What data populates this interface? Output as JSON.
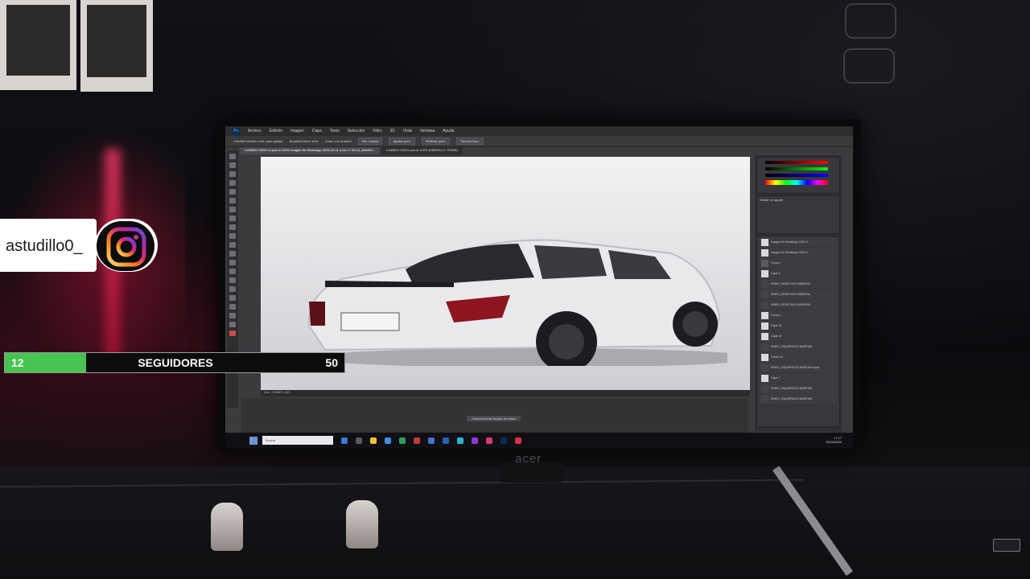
{
  "overlay": {
    "instagram_handle": "astudillo0_",
    "instagram_icon": "instagram-icon",
    "follower_goal": {
      "current": "12",
      "label": "SEGUIDORES",
      "goal": "50",
      "progress_fraction": 0.24,
      "fill_color": "#46c44f"
    }
  },
  "monitor": {
    "brand": "acer"
  },
  "photoshop": {
    "menu": [
      "Archivo",
      "Edición",
      "Imagen",
      "Capa",
      "Texto",
      "Selección",
      "Filtro",
      "3D",
      "Vista",
      "Ventana",
      "Ayuda"
    ],
    "options": {
      "text1": "Cambiar tamaño vent. para ajustar",
      "text2": "Ampliar/reducir vent.",
      "text3": "Zoom con arrastre",
      "btn1": "Rel. natural",
      "btn2": "Ajustar pant.",
      "btn3": "Rellenar pant.",
      "btn4": "Tamaño impr."
    },
    "tabs": [
      "CAMBIO CARO-O.psd al 100% Imagen de WhatsApp 2024-04-11 a las 17.55.16_800499...",
      "CAMBIO CARO.psd al 100% (HIBERIA 2, RGB/8)"
    ],
    "status_text": "Doc: 2.82M/1.15G",
    "timeline_button": "Crear línea de tiempo de vídeo",
    "layers": [
      "Imagen de WhatsApp 2024-0...",
      "Imagen de WhatsApp 2024-0...",
      "Grupo 1",
      "Capa 4",
      "RINES_DERECHOS-MAREMA",
      "RINES_DERECHOS-MAREMA",
      "RINES_DERECHOS-MAREMA",
      "Fondo 1",
      "Capa 15",
      "Capa 18",
      "RINES_IZQUIERDOS-MAREMA",
      "Fondo 10",
      "RINES_IZQUIERDOS-MAREMA copia",
      "Capa 7",
      "RINES_IZQUIERDOS-MAREMA",
      "RINES_IZQUIERDOS-MAREMA"
    ],
    "adjust_title": "Añadir un ajuste",
    "taskbar": {
      "search_placeholder": "Buscar",
      "time": "17:17",
      "date": "10/04/2024"
    }
  }
}
